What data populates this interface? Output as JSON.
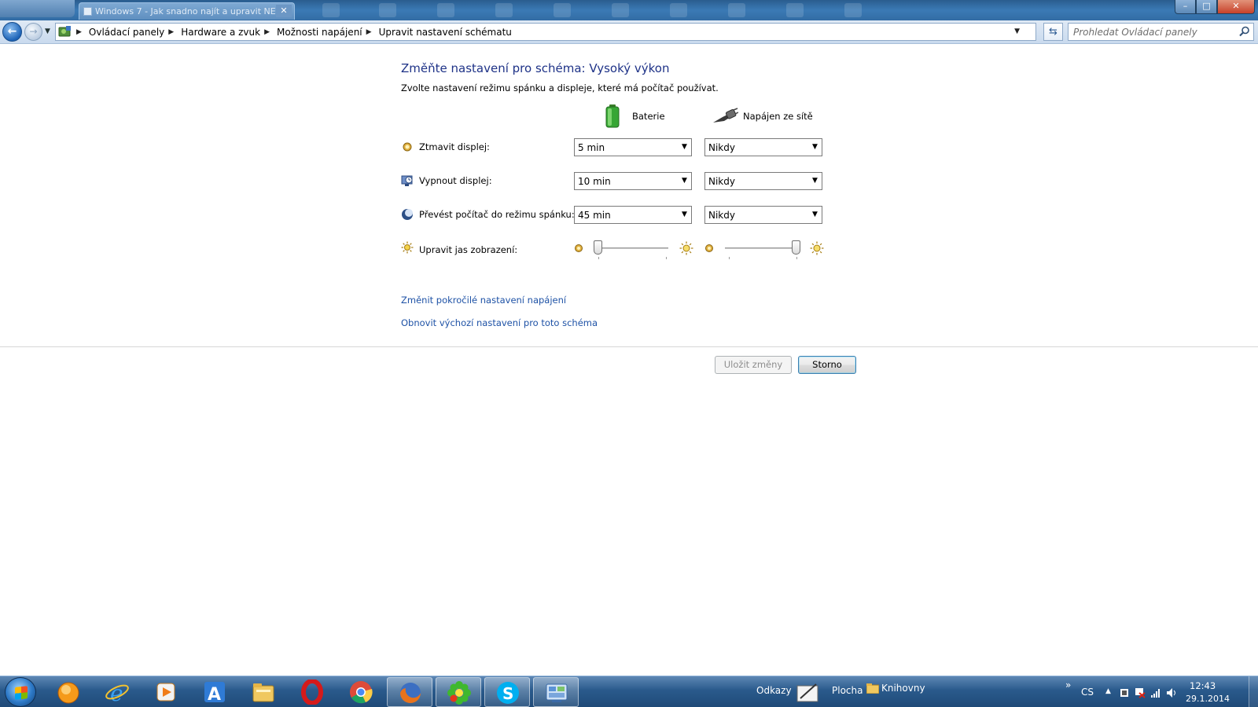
{
  "window": {
    "tab_title": "Windows 7 - Jak snadno najít a upravit NE...",
    "controls": {
      "minimize": "–",
      "maximize": "□",
      "close": "✕"
    }
  },
  "address": {
    "breadcrumbs": [
      "Ovládací panely",
      "Hardware a zvuk",
      "Možnosti napájení",
      "Upravit nastavení schématu"
    ],
    "search_placeholder": "Prohledat Ovládací panely"
  },
  "main": {
    "title": "Změňte nastavení pro schéma: Vysoký výkon",
    "subtitle": "Zvolte nastavení režimu spánku a displeje, které má počítač používat.",
    "columns": {
      "battery": "Baterie",
      "ac": "Napájen ze sítě"
    },
    "rows": [
      {
        "label": "Ztmavit displej:",
        "icon": "dim-display-icon",
        "battery": "5 min",
        "ac": "Nikdy"
      },
      {
        "label": "Vypnout displej:",
        "icon": "turn-off-display-icon",
        "battery": "10 min",
        "ac": "Nikdy"
      },
      {
        "label": "Převést počítač do režimu spánku:",
        "icon": "sleep-icon",
        "battery": "45 min",
        "ac": "Nikdy"
      }
    ],
    "brightness": {
      "label": "Upravit jas zobrazení:",
      "battery_level": 0.0,
      "ac_level": 1.0
    },
    "links": {
      "advanced": "Změnit pokročilé nastavení napájení",
      "restore": "Obnovit výchozí nastavení pro toto schéma"
    },
    "buttons": {
      "save": "Uložit změny",
      "cancel": "Storno"
    }
  },
  "taskbar": {
    "apps": [
      "media-player-icon",
      "internet-explorer-icon",
      "media-center-icon",
      "app-a-icon",
      "explorer-icon",
      "opera-icon",
      "chrome-icon",
      "firefox-icon",
      "icq-icon",
      "skype-icon",
      "control-panel-icon"
    ],
    "toolbars": {
      "links": "Odkazy",
      "desktop": "Plocha",
      "libraries": "Knihovny"
    },
    "tray": {
      "chevron": "»",
      "language": "CS",
      "time": "12:43",
      "date": "29.1.2014"
    }
  },
  "colors": {
    "title_blue": "#1e3287",
    "link_blue": "#1e52a6",
    "taskbar": "#2a5a8c"
  }
}
